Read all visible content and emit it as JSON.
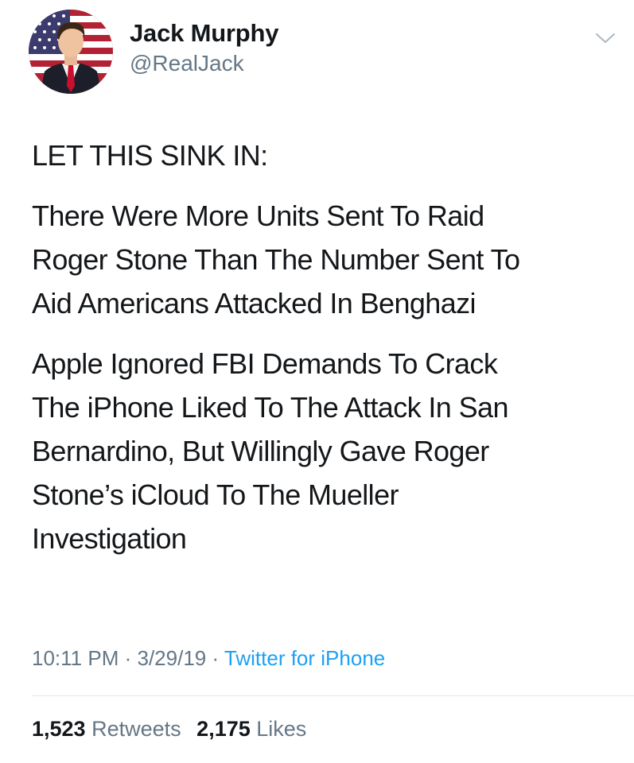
{
  "user": {
    "display_name": "Jack Murphy",
    "handle": "@RealJack"
  },
  "tweet": {
    "paragraphs": [
      "LET THIS SINK IN:",
      "There Were More Units Sent To Raid\nRoger Stone Than The Number Sent To\nAid Americans Attacked In Benghazi",
      "Apple Ignored FBI Demands To Crack\nThe iPhone Liked To The Attack In San\nBernardino, But Willingly Gave Roger\nStone’s iCloud To The Mueller\nInvestigation"
    ],
    "time": "10:11 PM",
    "date": "3/29/19",
    "separator": "·",
    "source": "Twitter for iPhone"
  },
  "stats": {
    "retweets_count": "1,523",
    "retweets_label": "Retweets",
    "likes_count": "2,175",
    "likes_label": "Likes"
  },
  "icons": {
    "chevron": "chevron-down-icon"
  },
  "colors": {
    "link": "#1da1f2",
    "secondary_text": "#657786",
    "primary_text": "#14171a",
    "divider": "#e1e8ed"
  }
}
